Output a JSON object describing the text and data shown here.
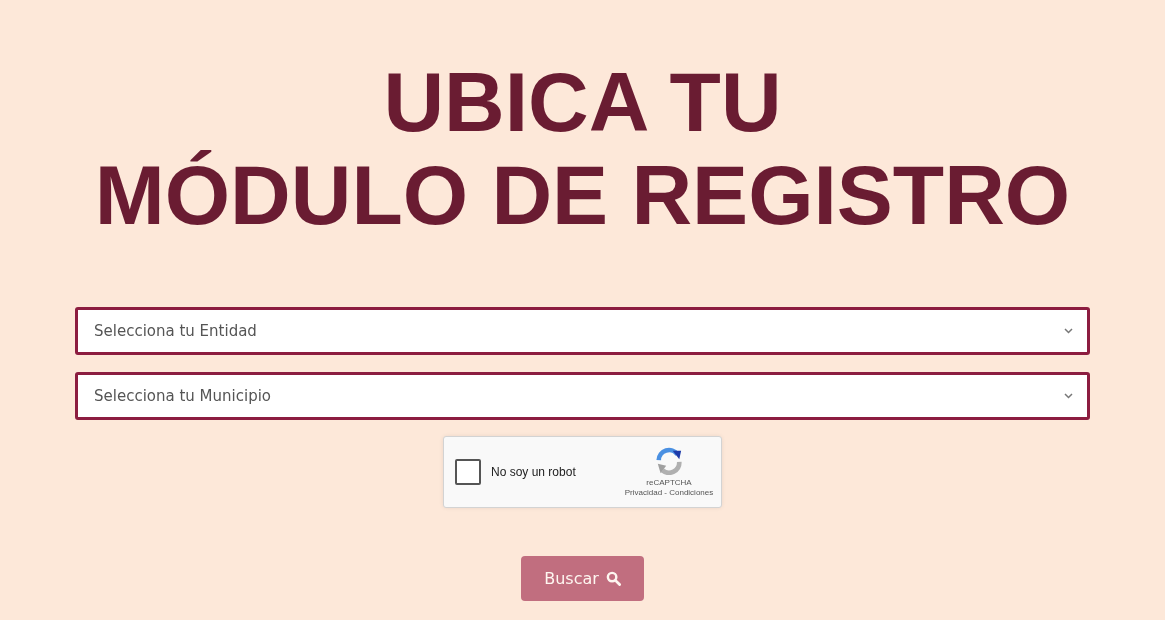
{
  "title": {
    "lines": [
      "UBICA TU",
      "MÓDULO DE REGISTRO"
    ]
  },
  "selects": [
    {
      "placeholder": "Selecciona tu Entidad"
    },
    {
      "placeholder": "Selecciona tu Municipio"
    }
  ],
  "captcha": {
    "label": "No soy un robot",
    "checked": false,
    "brand": "reCAPTCHA",
    "links": "Privacidad - Condiciones"
  },
  "search_button": {
    "label": "Buscar",
    "disabled": true
  }
}
